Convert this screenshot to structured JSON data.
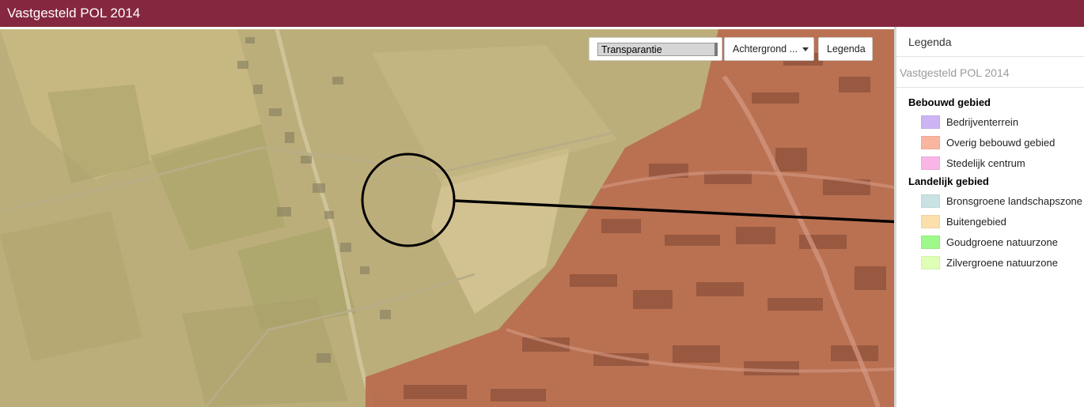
{
  "header": {
    "title": "Vastgesteld POL 2014"
  },
  "toolbar": {
    "transparency_label": "Transparantie",
    "transparency_value": 0.97,
    "background_label": "Achtergrond ...",
    "legend_button_label": "Legenda"
  },
  "legend": {
    "title": "Legenda",
    "layer_name": "Vastgesteld POL 2014",
    "groups": [
      {
        "label": "Bebouwd gebied",
        "items": [
          {
            "label": "Bedrijventerrein",
            "color": "#cdb5f5"
          },
          {
            "label": "Overig bebouwd gebied",
            "color": "#f9b5a0"
          },
          {
            "label": "Stedelijk centrum",
            "color": "#f9b5e6"
          }
        ]
      },
      {
        "label": "Landelijk gebied",
        "items": [
          {
            "label": "Bronsgroene landschapszone",
            "color": "#c9e2e3"
          },
          {
            "label": "Buitengebied",
            "color": "#fbe0ab"
          },
          {
            "label": "Goudgroene natuurzone",
            "color": "#9ff98a"
          },
          {
            "label": "Zilvergroene natuurzone",
            "color": "#dfffb6"
          }
        ]
      }
    ]
  }
}
